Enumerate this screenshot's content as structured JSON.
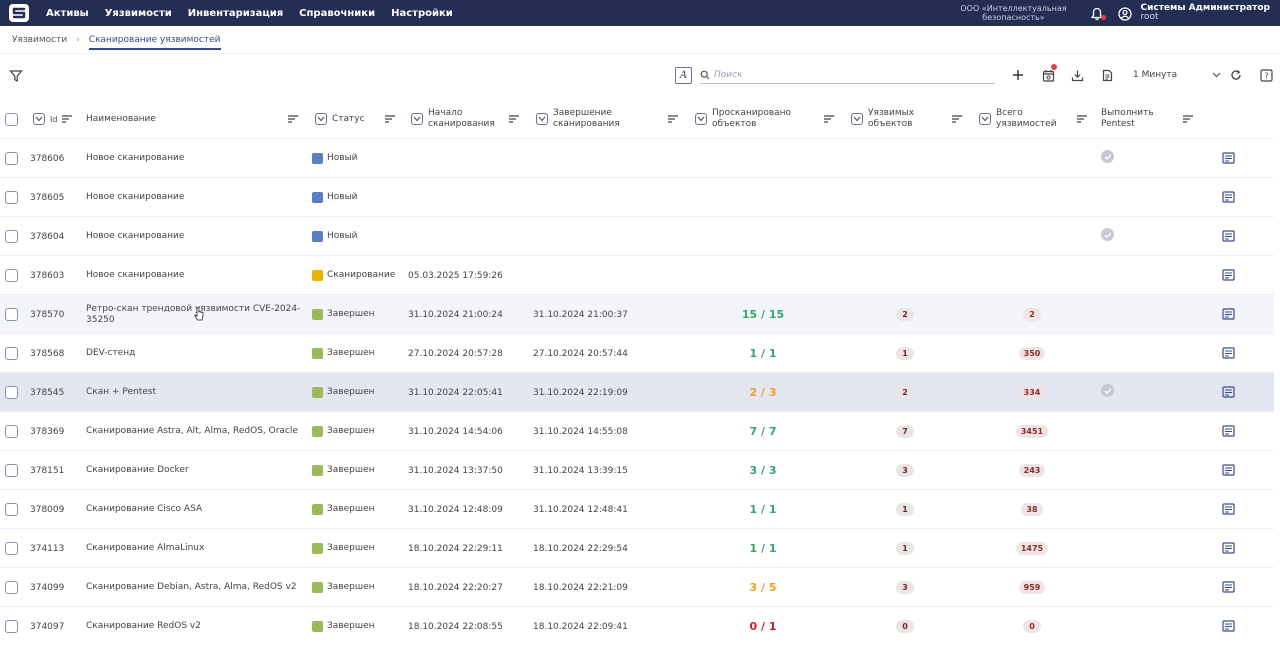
{
  "topbar": {
    "nav": [
      "Активы",
      "Уязвимости",
      "Инвентаризация",
      "Справочники",
      "Настройки"
    ],
    "org": "ООО «Интеллектуальная безопасность»",
    "user_name": "Системы Администратор",
    "user_login": "root",
    "accent": "#232e52"
  },
  "breadcrumbs": {
    "parent": "Уязвимости",
    "current": "Сканирование уязвимостей"
  },
  "toolbar": {
    "search_placeholder": "Поиск",
    "refresh_interval": "1 Минута",
    "a_label": "A"
  },
  "table": {
    "headers": {
      "id": "Id",
      "name": "Наименование",
      "status": "Статус",
      "start": "Начало сканирования",
      "end": "Завершение сканирования",
      "scanned": "Просканировано объектов",
      "vuln_objects": "Уязвимых объектов",
      "vuln_total": "Всего уязвимостей",
      "pentest": "Выполнить Pentest"
    },
    "rows": [
      {
        "id": "378606",
        "name": "Новое сканирование",
        "status": "Новый",
        "status_color": "#5b7fc0",
        "start": "",
        "end": "",
        "scanned": "",
        "scanned_color": "",
        "vobj": "",
        "vall": "",
        "pentest": true
      },
      {
        "id": "378605",
        "name": "Новое сканирование",
        "status": "Новый",
        "status_color": "#5b7fc0",
        "start": "",
        "end": "",
        "scanned": "",
        "scanned_color": "",
        "vobj": "",
        "vall": "",
        "pentest": false
      },
      {
        "id": "378604",
        "name": "Новое сканирование",
        "status": "Новый",
        "status_color": "#5b7fc0",
        "start": "",
        "end": "",
        "scanned": "",
        "scanned_color": "",
        "vobj": "",
        "vall": "",
        "pentest": true
      },
      {
        "id": "378603",
        "name": "Новое сканирование",
        "status": "Сканирование",
        "status_color": "#e8b400",
        "start": "05.03.2025 17:59:26",
        "end": "",
        "scanned": "",
        "scanned_color": "",
        "vobj": "",
        "vall": "",
        "pentest": false
      },
      {
        "id": "378570",
        "name": "Ретро-скан трендовой уязвимости CVE-2024-35250",
        "status": "Завершен",
        "status_color": "#9dba5a",
        "start": "31.10.2024 21:00:24",
        "end": "31.10.2024 21:00:37",
        "scanned": "15 / 15",
        "scanned_color": "green",
        "vobj": "2",
        "vall": "2",
        "pentest": false
      },
      {
        "id": "378568",
        "name": "DEV-стенд",
        "status": "Завершен",
        "status_color": "#9dba5a",
        "start": "27.10.2024 20:57:28",
        "end": "27.10.2024 20:57:44",
        "scanned": "1 / 1",
        "scanned_color": "green",
        "vobj": "1",
        "vall": "350",
        "pentest": false
      },
      {
        "id": "378545",
        "name": "Скан + Pentest",
        "status": "Завершен",
        "status_color": "#9dba5a",
        "start": "31.10.2024 22:05:41",
        "end": "31.10.2024 22:19:09",
        "scanned": "2 / 3",
        "scanned_color": "orange",
        "vobj": "2",
        "vall": "334",
        "pentest": true
      },
      {
        "id": "378369",
        "name": "Сканирование Astra, Alt, Alma, RedOS, Oracle",
        "status": "Завершен",
        "status_color": "#9dba5a",
        "start": "31.10.2024 14:54:06",
        "end": "31.10.2024 14:55:08",
        "scanned": "7 / 7",
        "scanned_color": "green",
        "vobj": "7",
        "vall": "3451",
        "pentest": false
      },
      {
        "id": "378151",
        "name": "Сканирование Docker",
        "status": "Завершен",
        "status_color": "#9dba5a",
        "start": "31.10.2024 13:37:50",
        "end": "31.10.2024 13:39:15",
        "scanned": "3 / 3",
        "scanned_color": "green",
        "vobj": "3",
        "vall": "243",
        "pentest": false
      },
      {
        "id": "378009",
        "name": "Сканирование Cisco ASA",
        "status": "Завершен",
        "status_color": "#9dba5a",
        "start": "31.10.2024 12:48:09",
        "end": "31.10.2024 12:48:41",
        "scanned": "1 / 1",
        "scanned_color": "green",
        "vobj": "1",
        "vall": "38",
        "pentest": false
      },
      {
        "id": "374113",
        "name": "Сканирование AlmaLinux",
        "status": "Завершен",
        "status_color": "#9dba5a",
        "start": "18.10.2024 22:29:11",
        "end": "18.10.2024 22:29:54",
        "scanned": "1 / 1",
        "scanned_color": "green",
        "vobj": "1",
        "vall": "1475",
        "pentest": false
      },
      {
        "id": "374099",
        "name": "Сканирование Debian, Astra, Alma, RedOS v2",
        "status": "Завершен",
        "status_color": "#9dba5a",
        "start": "18.10.2024 22:20:27",
        "end": "18.10.2024 22:21:09",
        "scanned": "3 / 5",
        "scanned_color": "orange",
        "vobj": "3",
        "vall": "959",
        "pentest": false
      },
      {
        "id": "374097",
        "name": "Сканирование RedOS v2",
        "status": "Завершен",
        "status_color": "#9dba5a",
        "start": "18.10.2024 22:08:55",
        "end": "18.10.2024 22:09:41",
        "scanned": "0 / 1",
        "scanned_color": "red",
        "vobj": "0",
        "vall": "0",
        "pentest": false
      }
    ]
  }
}
